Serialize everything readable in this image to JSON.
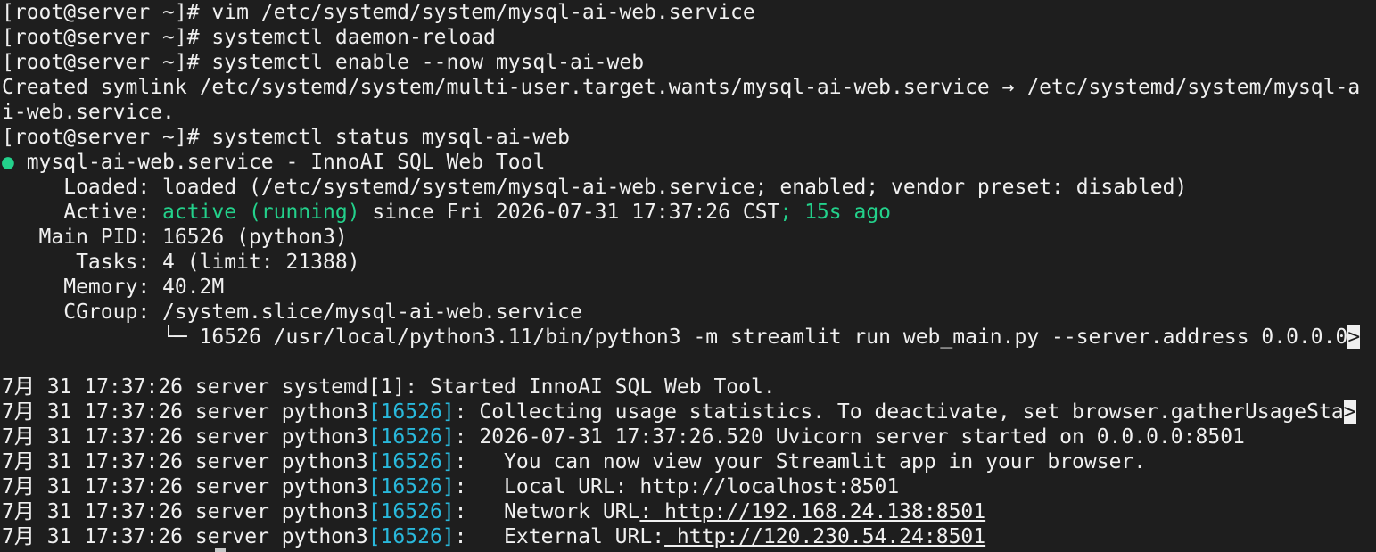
{
  "terminal": {
    "prompt": "[root@server ~]# ",
    "commands": {
      "vim": "vim /etc/systemd/system/mysql-ai-web.service",
      "reload": "systemctl daemon-reload",
      "enable": "systemctl enable --now mysql-ai-web",
      "status": "systemctl status mysql-ai-web"
    },
    "symlink": {
      "line1": "Created symlink /etc/systemd/system/multi-user.target.wants/mysql-ai-web.service → /etc/systemd/system/mysql-a",
      "line2": "i-web.service."
    },
    "status": {
      "bullet": "●",
      "unit_title": " mysql-ai-web.service - InnoAI SQL Web Tool",
      "loaded": "     Loaded: loaded (/etc/systemd/system/mysql-ai-web.service; enabled; vendor preset: disabled)",
      "active_label": "     Active: ",
      "active_state": "active (running)",
      "active_since": " since Fri 2026-07-31 17:37:26 CST",
      "active_ago": "; 15s ago",
      "main_pid": "   Main PID: 16526 (python3)",
      "tasks": "      Tasks: 4 (limit: 21388)",
      "memory": "     Memory: 40.2M",
      "cgroup": "     CGroup: /system.slice/mysql-ai-web.service",
      "cgroup_proc": "             └─ 16526 /usr/local/python3.11/bin/python3 -m streamlit run web_main.py --server.address 0.0.0.0",
      "overflow_marker": ">"
    },
    "logs": {
      "prefix": "7月 31 17:37:26 server ",
      "systemd": "systemd[1]: Started InnoAI SQL Web Tool.",
      "python_name": "python3",
      "pid": "[16526]",
      "msg1": ": Collecting usage statistics. To deactivate, set browser.gatherUsageSta",
      "msg2": ": 2026-07-31 17:37:26.520 Uvicorn server started on 0.0.0.0:8501",
      "msg3": ":   You can now view your Streamlit app in your browser.",
      "msg4": ":   Local URL: http://localhost:8501",
      "msg5_label": ":   Network URL",
      "msg5_url": ": http://192.168.24.138:8501",
      "msg6_label": ":   External URL:",
      "msg6_url": " http://120.230.54.24:8501"
    }
  }
}
